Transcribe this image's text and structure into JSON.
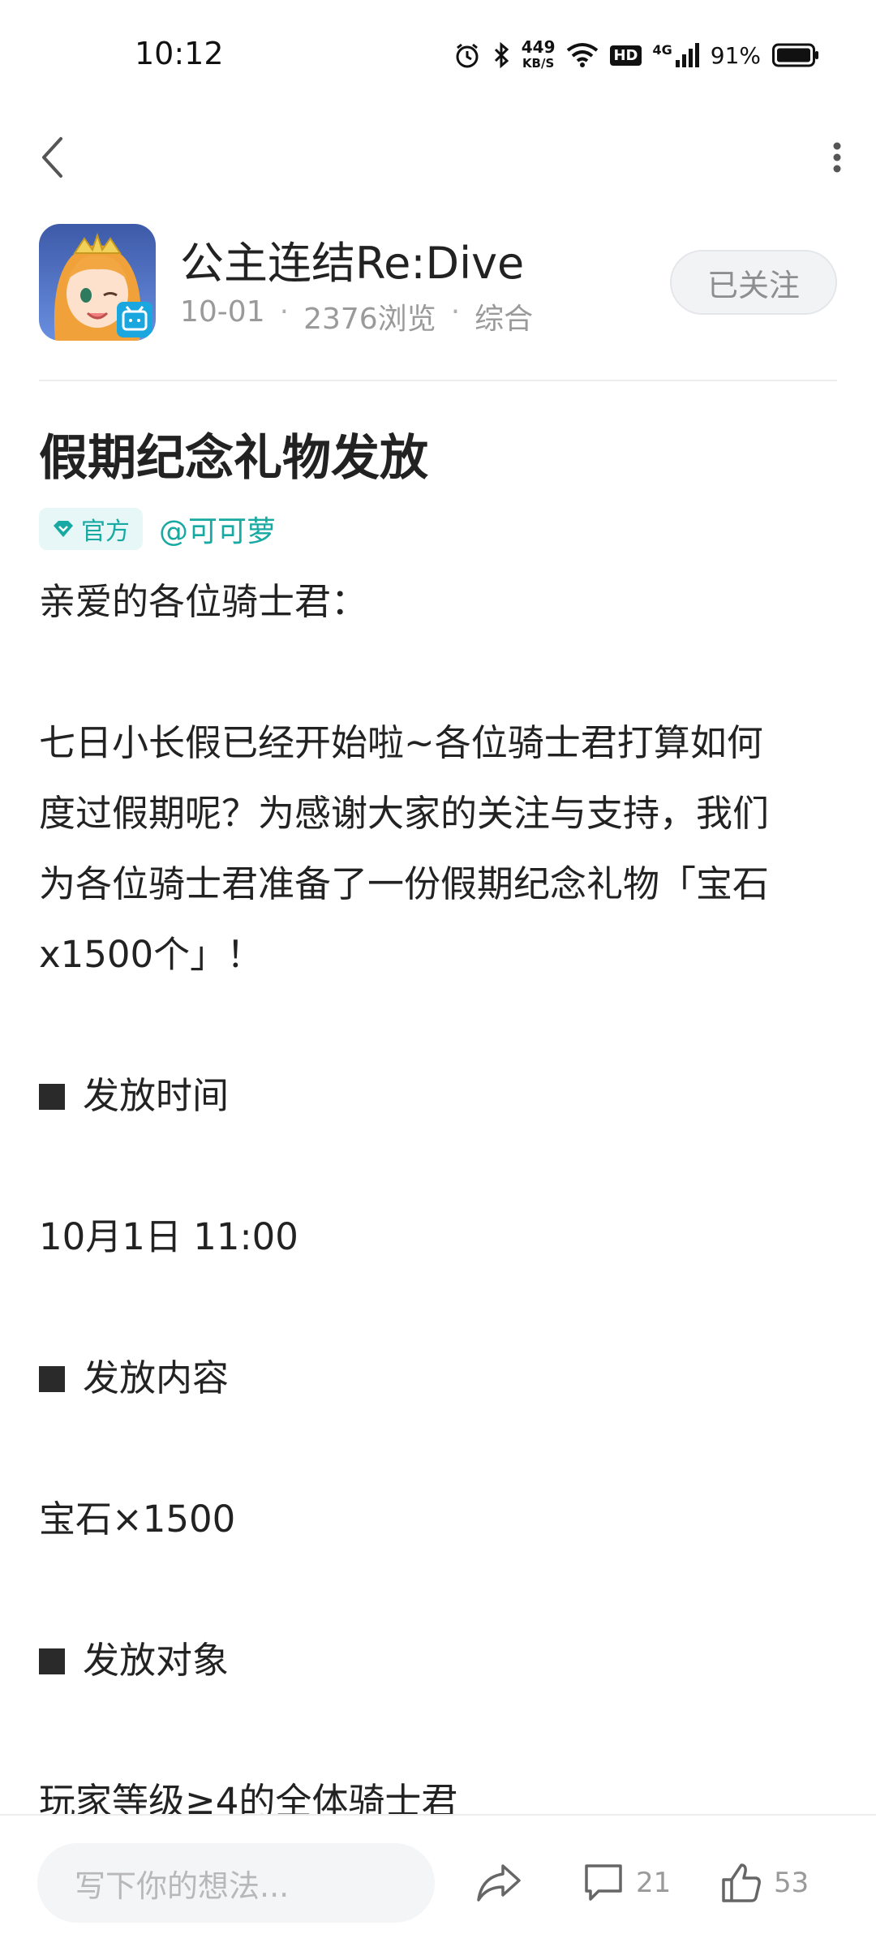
{
  "status_bar": {
    "time": "10:12",
    "net_speed_value": "449",
    "net_speed_unit": "KB/S",
    "hd": "HD",
    "network": "4G",
    "battery_percent": "91%",
    "icons": [
      "alarm-icon",
      "bluetooth-icon",
      "wifi-icon",
      "signal-icon",
      "battery-icon"
    ]
  },
  "nav": {
    "back_icon": "chevron-left-icon",
    "more_icon": "more-vertical-icon"
  },
  "channel": {
    "name": "公主连结Re:Dive",
    "date": "10-01",
    "views": "2376浏览",
    "category": "综合",
    "follow_label": "已关注"
  },
  "post": {
    "title": "假期纪念礼物发放",
    "official_label": "官方",
    "author": "@可可萝",
    "lines": {
      "greeting": "亲爱的各位骑士君：",
      "intro_1": "七日小长假已经开始啦~各位骑士君打算如何",
      "intro_2": "度过假期呢？为感谢大家的关注与支持，我们",
      "intro_3": "为各位骑士君准备了一份假期纪念礼物「宝石",
      "intro_4": "x1500个」！",
      "section_time": "发放时间",
      "time_value": "10月1日 11:00",
      "section_content": "发放内容",
      "content_value": "宝石×1500",
      "section_target": "发放对象",
      "target_value": "玩家等级≥4的全体骑士君"
    }
  },
  "bottom_bar": {
    "input_placeholder": "写下你的想法...",
    "comment_count": "21",
    "like_count": "53"
  },
  "colors": {
    "accent_teal": "#17a9a2",
    "badge_bg": "#e7f7f7",
    "muted_text": "#9a9a9a",
    "text": "#222222"
  }
}
